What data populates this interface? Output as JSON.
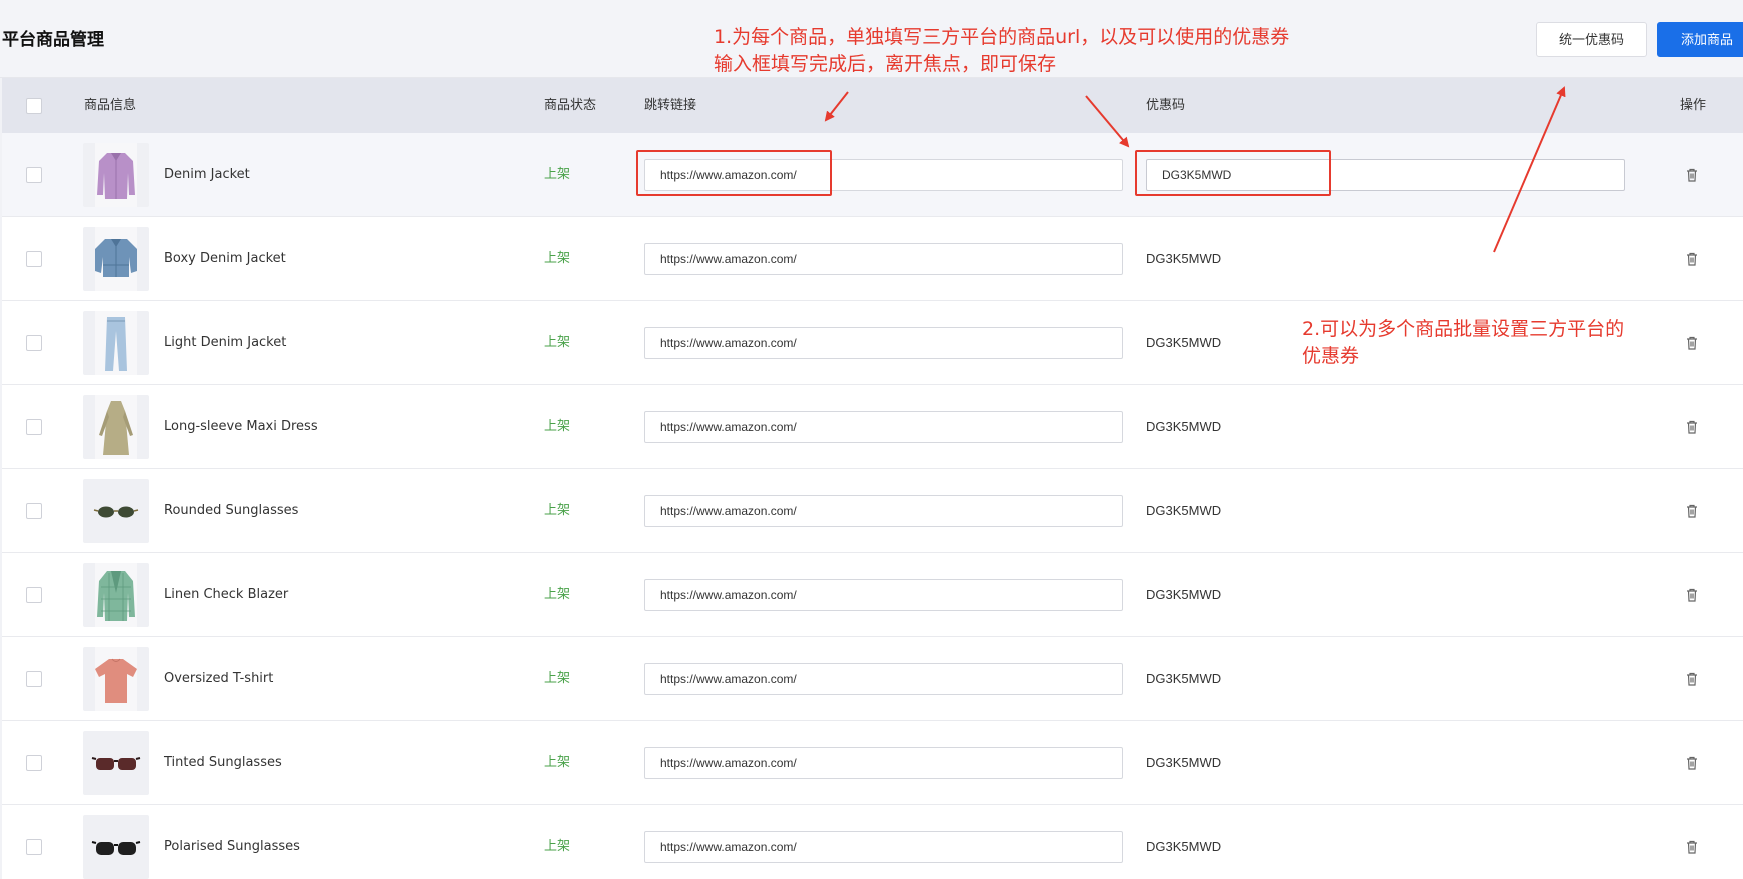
{
  "header": {
    "title": "平台商品管理",
    "unified_coupon_label": "统一优惠码",
    "add_product_label": "添加商品"
  },
  "table": {
    "columns": {
      "product_info": "商品信息",
      "status": "商品状态",
      "jump_link": "跳转链接",
      "coupon": "优惠码",
      "actions": "操作"
    },
    "rows": [
      {
        "name": "Denim Jacket",
        "status": "上架",
        "url": "https://www.amazon.com/",
        "coupon": "DG3K5MWD",
        "thumb_icon": "purple-jacket-image",
        "editing": true
      },
      {
        "name": "Boxy Denim Jacket",
        "status": "上架",
        "url": "https://www.amazon.com/",
        "coupon": "DG3K5MWD",
        "thumb_icon": "denim-jacket-image"
      },
      {
        "name": "Light Denim Jacket",
        "status": "上架",
        "url": "https://www.amazon.com/",
        "coupon": "DG3K5MWD",
        "thumb_icon": "light-jeans-image"
      },
      {
        "name": "Long-sleeve Maxi Dress",
        "status": "上架",
        "url": "https://www.amazon.com/",
        "coupon": "DG3K5MWD",
        "thumb_icon": "maxi-dress-image"
      },
      {
        "name": "Rounded Sunglasses",
        "status": "上架",
        "url": "https://www.amazon.com/",
        "coupon": "DG3K5MWD",
        "thumb_icon": "rounded-sunglasses-image"
      },
      {
        "name": "Linen Check Blazer",
        "status": "上架",
        "url": "https://www.amazon.com/",
        "coupon": "DG3K5MWD",
        "thumb_icon": "check-blazer-image"
      },
      {
        "name": "Oversized T-shirt",
        "status": "上架",
        "url": "https://www.amazon.com/",
        "coupon": "DG3K5MWD",
        "thumb_icon": "tshirt-image"
      },
      {
        "name": "Tinted Sunglasses",
        "status": "上架",
        "url": "https://www.amazon.com/",
        "coupon": "DG3K5MWD",
        "thumb_icon": "tinted-sunglasses-image"
      },
      {
        "name": "Polarised Sunglasses",
        "status": "上架",
        "url": "https://www.amazon.com/",
        "coupon": "DG3K5MWD",
        "thumb_icon": "polarised-sunglasses-image"
      }
    ]
  },
  "annotations": {
    "note1_line1": "1.为每个商品，单独填写三方平台的商品url，以及可以使用的优惠券",
    "note1_line2": "输入框填写完成后，离开焦点，即可保存",
    "note2_line1": "2.可以为多个商品批量设置三方平台的",
    "note2_line2": "优惠券"
  },
  "colors": {
    "primary": "#1a6fe8",
    "status_green": "#4aa24a",
    "annotation_red": "#e63a2e",
    "header_bg": "#e3e5ed"
  }
}
